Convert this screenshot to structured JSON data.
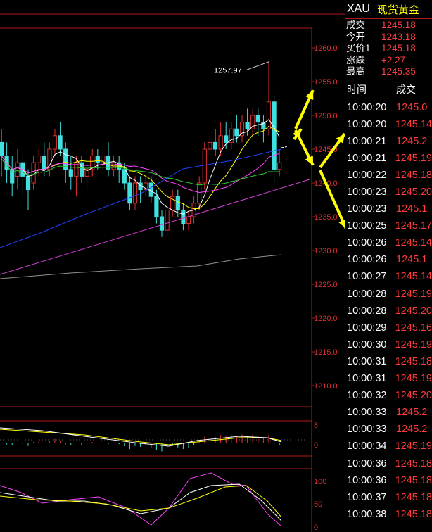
{
  "header": {
    "symbol": "XAU",
    "name": "现货黄金"
  },
  "quote": [
    {
      "label": "成交",
      "value": "1245.18"
    },
    {
      "label": "今开",
      "value": "1243.18"
    },
    {
      "label": "买价1",
      "value": "1245.18"
    },
    {
      "label": "涨跌",
      "value": "+2.27"
    },
    {
      "label": "最高",
      "value": "1245.35"
    }
  ],
  "ticks_header": {
    "time": "时间",
    "trade": "成交"
  },
  "ticks": [
    {
      "time": "10:00:20",
      "price": "1245.0"
    },
    {
      "time": "10:00:20",
      "price": "1245.14"
    },
    {
      "time": "10:00:21",
      "price": "1245.2"
    },
    {
      "time": "10:00:21",
      "price": "1245.19"
    },
    {
      "time": "10:00:22",
      "price": "1245.18"
    },
    {
      "time": "10:00:23",
      "price": "1245.20"
    },
    {
      "time": "10:00:23",
      "price": "1245.1"
    },
    {
      "time": "10:00:25",
      "price": "1245.17"
    },
    {
      "time": "10:00:26",
      "price": "1245.14"
    },
    {
      "time": "10:00:26",
      "price": "1245.1"
    },
    {
      "time": "10:00:27",
      "price": "1245.14"
    },
    {
      "time": "10:00:28",
      "price": "1245.19"
    },
    {
      "time": "10:00:28",
      "price": "1245.20"
    },
    {
      "time": "10:00:29",
      "price": "1245.16"
    },
    {
      "time": "10:00:30",
      "price": "1245.19"
    },
    {
      "time": "10:00:31",
      "price": "1245.18"
    },
    {
      "time": "10:00:31",
      "price": "1245.19"
    },
    {
      "time": "10:00:32",
      "price": "1245.20"
    },
    {
      "time": "10:00:33",
      "price": "1245.2"
    },
    {
      "time": "10:00:33",
      "price": "1245.2"
    },
    {
      "time": "10:00:34",
      "price": "1245.19"
    },
    {
      "time": "10:00:36",
      "price": "1245.18"
    },
    {
      "time": "10:00:36",
      "price": "1245.18"
    },
    {
      "time": "10:00:37",
      "price": "1245.18"
    },
    {
      "time": "10:00:38",
      "price": "1245.18"
    }
  ],
  "chart": {
    "price_ticks": [
      "1260.0",
      "1255.0",
      "1250.0",
      "1245.0",
      "1240.0",
      "1235.0",
      "1230.0",
      "1225.0",
      "1220.0",
      "1215.0",
      "1210.0"
    ],
    "high_label": "1257.97",
    "macd_ticks": [
      "5",
      "0"
    ],
    "kdj_ticks": [
      "100",
      "50",
      "0"
    ],
    "candles": [
      [
        1246,
        1244,
        1248,
        1241
      ],
      [
        1244,
        1242,
        1246,
        1240
      ],
      [
        1242,
        1240,
        1244,
        1238
      ],
      [
        1241,
        1243,
        1245,
        1239
      ],
      [
        1243,
        1241,
        1244,
        1238
      ],
      [
        1241,
        1239,
        1242,
        1236
      ],
      [
        1240,
        1243,
        1244,
        1239
      ],
      [
        1243,
        1244,
        1245,
        1241
      ],
      [
        1244,
        1242,
        1246,
        1241
      ],
      [
        1242,
        1245,
        1246,
        1241
      ],
      [
        1245,
        1247,
        1248,
        1244
      ],
      [
        1247,
        1245,
        1249,
        1244
      ],
      [
        1245,
        1242,
        1246,
        1240
      ],
      [
        1242,
        1241,
        1244,
        1239
      ],
      [
        1241,
        1243,
        1244,
        1238
      ],
      [
        1243,
        1241,
        1244,
        1240
      ],
      [
        1241,
        1242,
        1243,
        1239
      ],
      [
        1242,
        1244,
        1245,
        1241
      ],
      [
        1244,
        1243,
        1245,
        1242
      ],
      [
        1243,
        1244,
        1245,
        1242
      ],
      [
        1244,
        1242,
        1246,
        1241
      ],
      [
        1242,
        1243,
        1244,
        1241
      ],
      [
        1243,
        1242,
        1244,
        1240
      ],
      [
        1242,
        1240,
        1243,
        1239
      ],
      [
        1240,
        1237,
        1241,
        1236
      ],
      [
        1237,
        1240,
        1241,
        1236
      ],
      [
        1240,
        1239,
        1241,
        1237
      ],
      [
        1239,
        1240,
        1241,
        1238
      ],
      [
        1240,
        1238,
        1241,
        1237
      ],
      [
        1238,
        1235,
        1239,
        1234
      ],
      [
        1235,
        1233,
        1236,
        1232
      ],
      [
        1233,
        1236,
        1237,
        1232
      ],
      [
        1236,
        1238,
        1239,
        1235
      ],
      [
        1238,
        1236,
        1239,
        1235
      ],
      [
        1236,
        1234,
        1237,
        1233
      ],
      [
        1234,
        1235,
        1236,
        1233
      ],
      [
        1235,
        1237,
        1238,
        1234
      ],
      [
        1237,
        1240,
        1241,
        1236
      ],
      [
        1240,
        1245,
        1246,
        1239
      ],
      [
        1245,
        1246,
        1247,
        1244
      ],
      [
        1246,
        1245,
        1248,
        1244
      ],
      [
        1245,
        1247,
        1249,
        1244
      ],
      [
        1247,
        1246,
        1249,
        1245
      ],
      [
        1246,
        1248,
        1249,
        1245
      ],
      [
        1248,
        1247,
        1250,
        1246
      ],
      [
        1247,
        1249,
        1250,
        1246
      ],
      [
        1249,
        1248,
        1251,
        1247
      ],
      [
        1248,
        1250,
        1251,
        1247
      ],
      [
        1250,
        1249,
        1251,
        1247
      ],
      [
        1249,
        1248,
        1250,
        1246
      ],
      [
        1248,
        1252,
        1257.97,
        1247
      ],
      [
        1252,
        1242,
        1253,
        1240
      ],
      [
        1242,
        1243,
        1245,
        1241
      ]
    ]
  }
}
